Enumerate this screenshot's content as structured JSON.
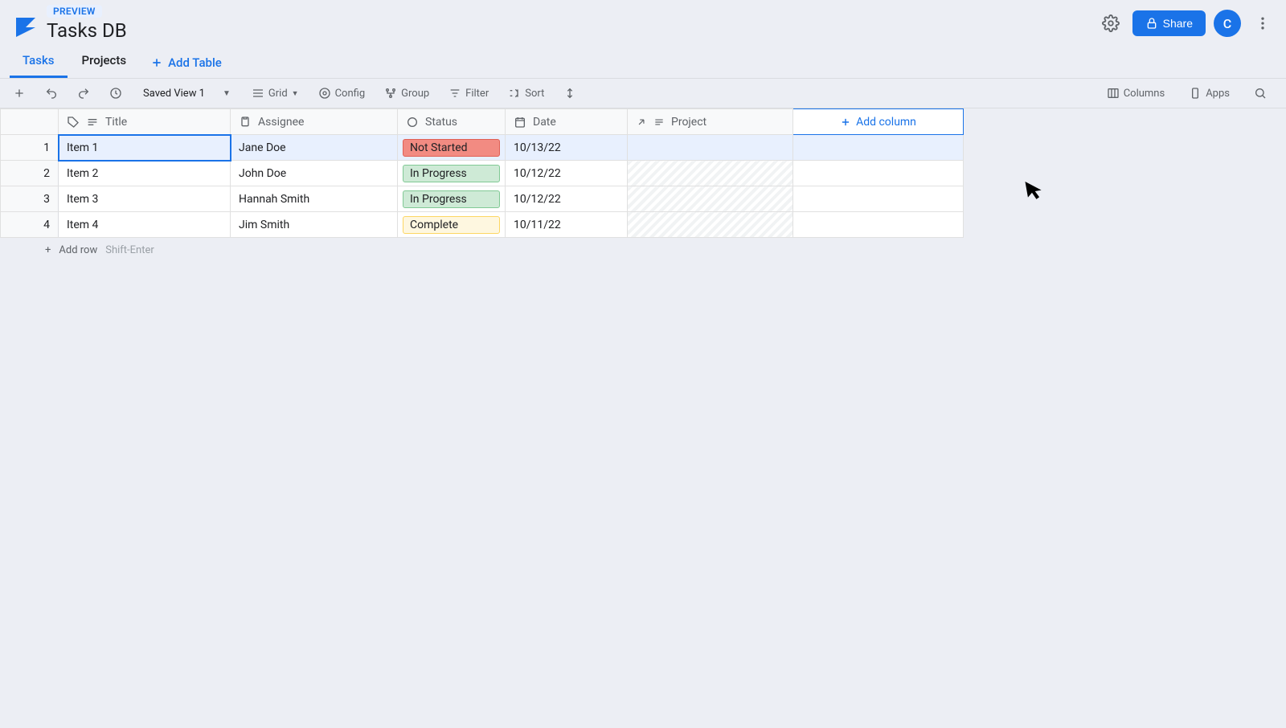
{
  "header": {
    "preview_badge": "PREVIEW",
    "title": "Tasks DB",
    "share_label": "Share",
    "avatar_initial": "C"
  },
  "tabs": {
    "items": [
      {
        "label": "Tasks",
        "active": true
      },
      {
        "label": "Projects",
        "active": false
      }
    ],
    "add_table_label": "Add Table"
  },
  "toolbar": {
    "saved_view_label": "Saved View 1",
    "grid_label": "Grid",
    "config_label": "Config",
    "group_label": "Group",
    "filter_label": "Filter",
    "sort_label": "Sort",
    "columns_label": "Columns",
    "apps_label": "Apps"
  },
  "columns": {
    "title": "Title",
    "assignee": "Assignee",
    "status": "Status",
    "date": "Date",
    "project": "Project",
    "add_column": "Add column"
  },
  "rows": [
    {
      "num": "1",
      "title": "Item 1",
      "assignee": "Jane Doe",
      "status": "Not Started",
      "status_class": "status-notstarted",
      "date": "10/13/22",
      "project": ""
    },
    {
      "num": "2",
      "title": "Item 2",
      "assignee": "John Doe",
      "status": "In Progress",
      "status_class": "status-inprogress",
      "date": "10/12/22",
      "project": ""
    },
    {
      "num": "3",
      "title": "Item 3",
      "assignee": "Hannah Smith",
      "status": "In Progress",
      "status_class": "status-inprogress",
      "date": "10/12/22",
      "project": ""
    },
    {
      "num": "4",
      "title": "Item 4",
      "assignee": "Jim Smith",
      "status": "Complete",
      "status_class": "status-complete",
      "date": "10/11/22",
      "project": ""
    }
  ],
  "footer": {
    "add_row_label": "Add row",
    "add_row_hint": "Shift-Enter"
  }
}
